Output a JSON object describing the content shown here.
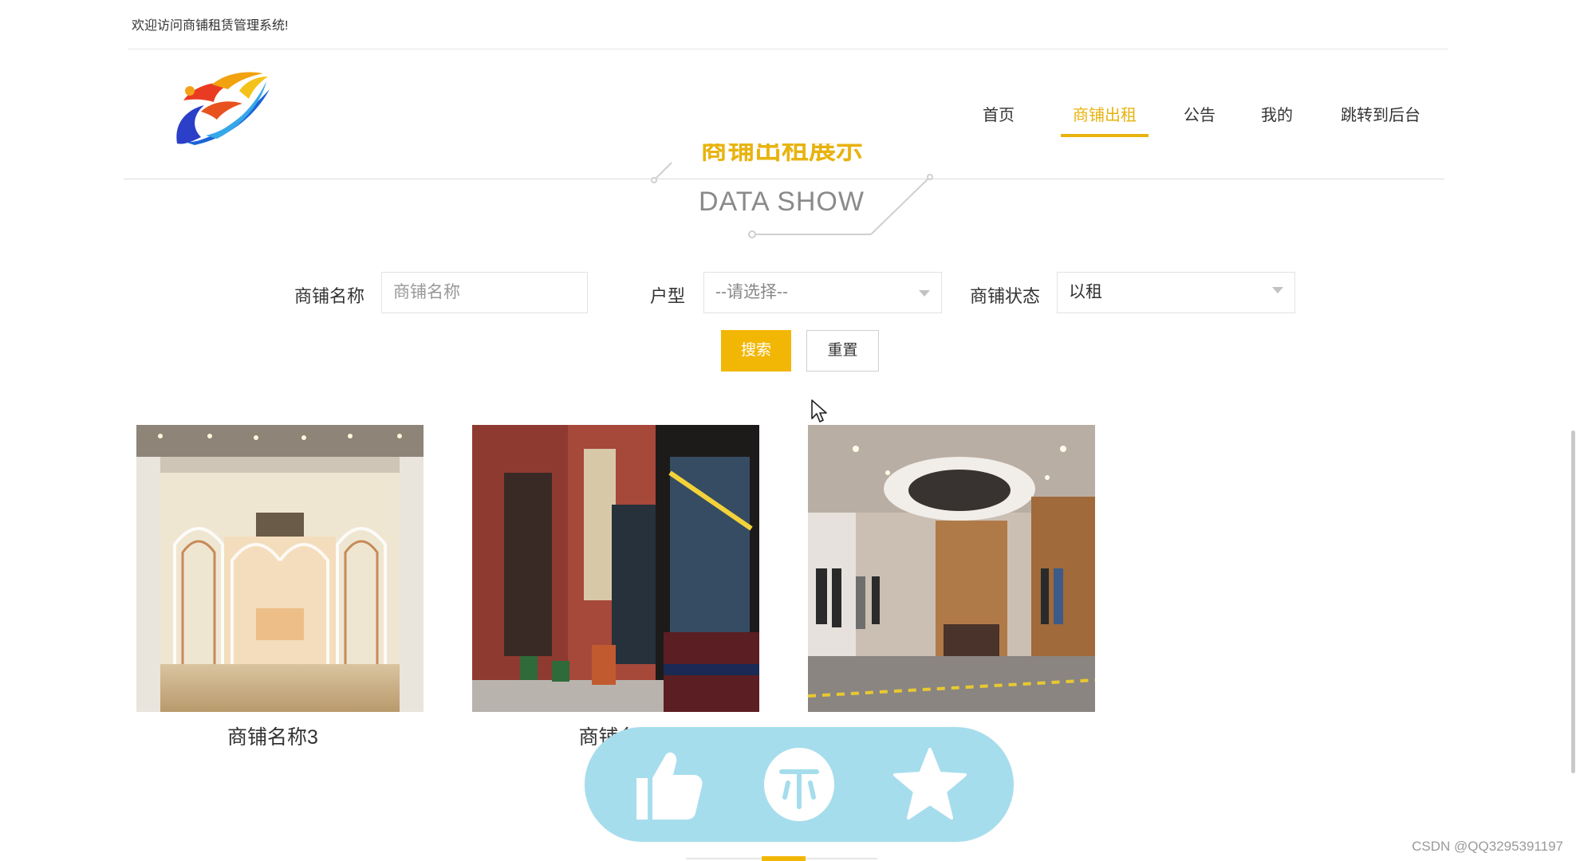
{
  "topbar": {
    "welcome": "欢迎访问商铺租赁管理系统!"
  },
  "nav": {
    "items": [
      {
        "label": "首页",
        "active": false
      },
      {
        "label": "商铺出租",
        "active": true
      },
      {
        "label": "公告",
        "active": false
      },
      {
        "label": "我的",
        "active": false
      },
      {
        "label": "跳转到后台",
        "active": false
      }
    ]
  },
  "section": {
    "title_cn": "商铺出租展示",
    "title_en": "DATA SHOW"
  },
  "filters": {
    "name_label": "商铺名称",
    "name_placeholder": "商铺名称",
    "type_label": "户型",
    "type_value": "--请选择--",
    "status_label": "商铺状态",
    "status_value": "以租"
  },
  "buttons": {
    "search": "搜索",
    "reset": "重置"
  },
  "cards": [
    {
      "name": "商铺名称3",
      "image": "store-interior-white-gate"
    },
    {
      "name": "商铺名",
      "image": "street-storefront"
    },
    {
      "name": "",
      "image": "clothing-store-interior"
    }
  ],
  "floating_bar": {
    "icons": [
      "thumbs-up-icon",
      "coin-icon",
      "star-icon"
    ]
  },
  "watermark": "CSDN @QQ3295391197",
  "colors": {
    "accent": "#e8b30f",
    "search_button": "#f2b705",
    "floating_bar": "#a6dded"
  }
}
